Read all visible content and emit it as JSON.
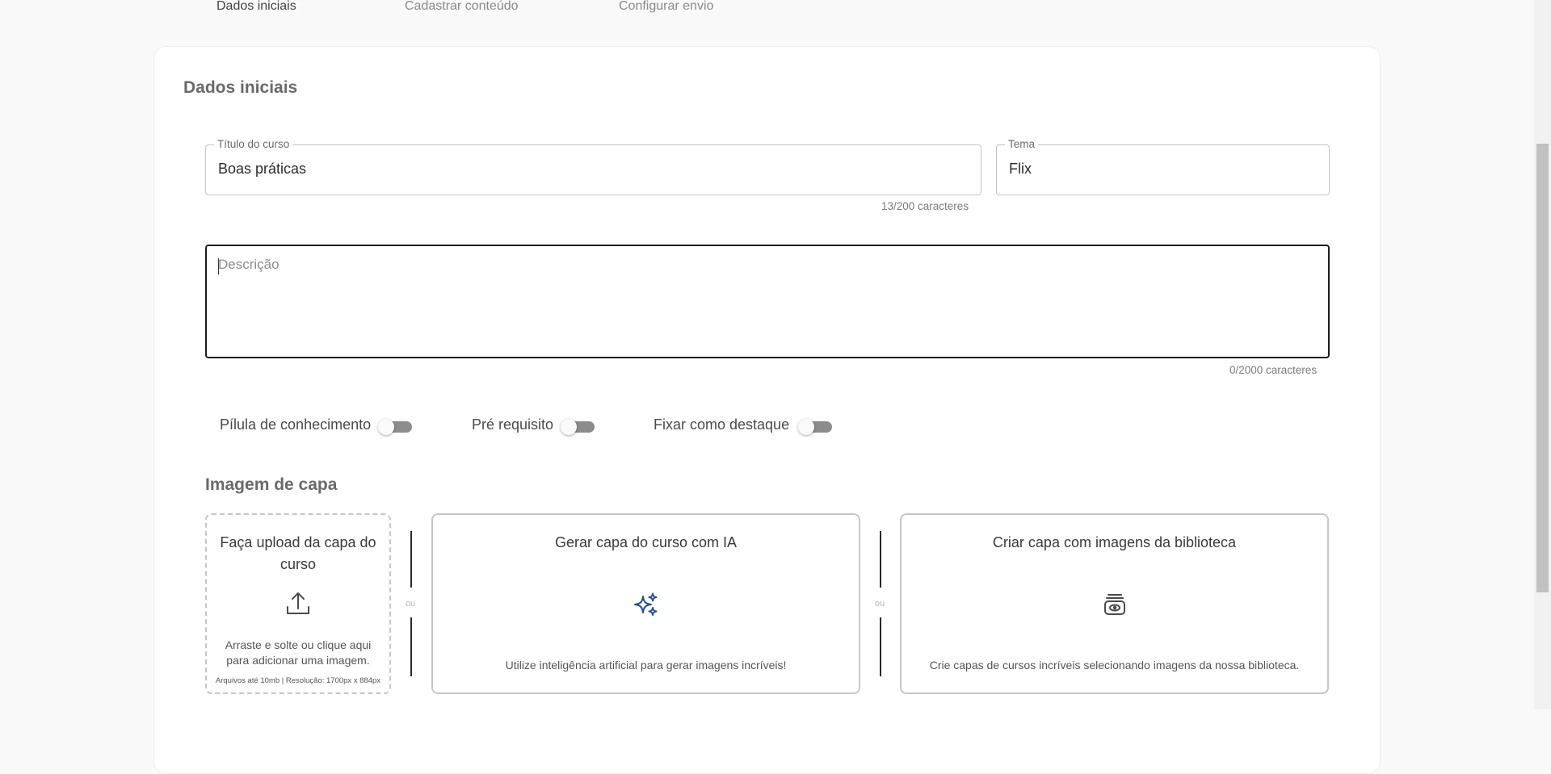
{
  "stepper": {
    "steps": [
      {
        "label": "Dados iniciais",
        "active": true
      },
      {
        "label": "Cadastrar conteúdo",
        "active": false
      },
      {
        "label": "Configurar envio",
        "active": false
      }
    ]
  },
  "form": {
    "section_title": "Dados iniciais",
    "course_title": {
      "label": "Título do curso",
      "value": "Boas práticas",
      "counter": "13/200 caracteres"
    },
    "theme": {
      "label": "Tema",
      "value": "Flix"
    },
    "description": {
      "placeholder": "Descrição",
      "counter": "0/2000 caracteres"
    },
    "toggles": [
      {
        "label": "Pílula de conhecimento",
        "checked": false
      },
      {
        "label": "Pré requisito",
        "checked": false
      },
      {
        "label": "Fixar como destaque",
        "checked": false
      }
    ]
  },
  "cover": {
    "section_title": "Imagem de capa",
    "separator_label": "ou",
    "upload": {
      "title": "Faça upload da capa do curso",
      "icon": "upload-icon",
      "description": "Arraste e solte ou clique aqui para adicionar uma imagem.",
      "limits": "Arquivos até 10mb | Resolução: 1700px x 884px"
    },
    "ai": {
      "title": "Gerar capa do curso com IA",
      "icon": "sparkles-icon",
      "icon_color": "#1d4f9e",
      "description": "Utilize inteligência artificial para gerar imagens incríveis!"
    },
    "library": {
      "title": "Criar capa com imagens da biblioteca",
      "icon": "image-library-icon",
      "description": "Crie capas de cursos incríveis selecionando imagens da nossa biblioteca."
    }
  },
  "colors": {
    "page_bg": "#f9f9f9",
    "card_bg": "#ffffff",
    "focus_border": "#1e1e1e",
    "toggle_off": "#8c8c8c"
  }
}
